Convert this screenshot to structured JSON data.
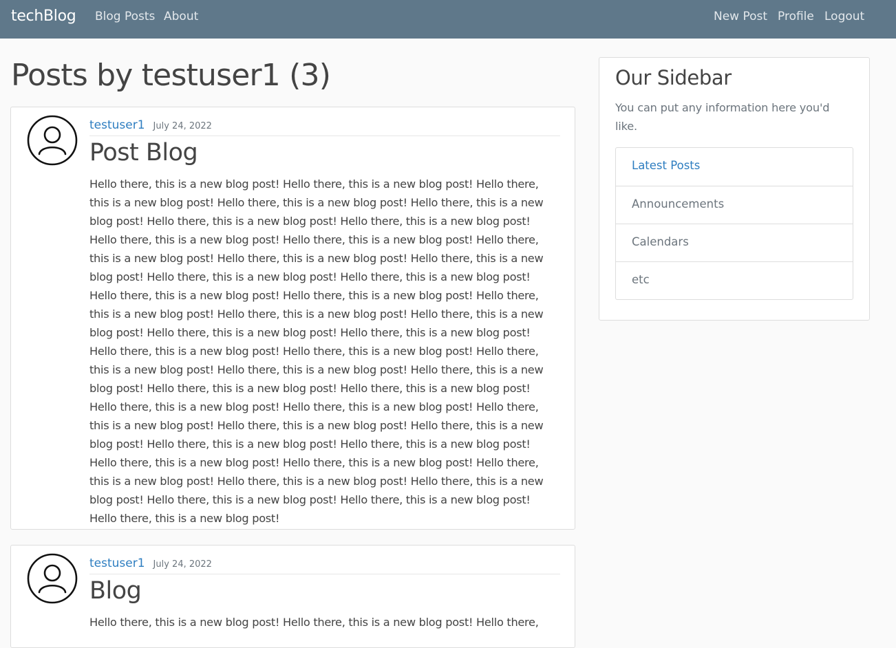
{
  "navbar": {
    "brand": "techBlog",
    "left_links": [
      "Blog Posts",
      "About"
    ],
    "right_links": [
      "New Post",
      "Profile",
      "Logout"
    ]
  },
  "page": {
    "title": "Posts by testuser1 (3)"
  },
  "posts": [
    {
      "author": "testuser1",
      "date": "July 24, 2022",
      "title": "Post Blog",
      "content": "Hello there, this is a new blog post! Hello there, this is a new blog post! Hello there, this is a new blog post! Hello there, this is a new blog post! Hello there, this is a new blog post! Hello there, this is a new blog post! Hello there, this is a new blog post! Hello there, this is a new blog post! Hello there, this is a new blog post! Hello there, this is a new blog post! Hello there, this is a new blog post! Hello there, this is a new blog post! Hello there, this is a new blog post! Hello there, this is a new blog post! Hello there, this is a new blog post! Hello there, this is a new blog post! Hello there, this is a new blog post! Hello there, this is a new blog post! Hello there, this is a new blog post! Hello there, this is a new blog post! Hello there, this is a new blog post! Hello there, this is a new blog post! Hello there, this is a new blog post! Hello there, this is a new blog post! Hello there, this is a new blog post! Hello there, this is a new blog post! Hello there, this is a new blog post! Hello there, this is a new blog post! Hello there, this is a new blog post! Hello there, this is a new blog post! Hello there, this is a new blog post! Hello there, this is a new blog post! Hello there, this is a new blog post! Hello there, this is a new blog post! Hello there, this is a new blog post! Hello there, this is a new blog post! Hello there, this is a new blog post! Hello there, this is a new blog post! Hello there, this is a new blog post! Hello there, this is a new blog post! Hello there, this is a new blog post! Hello there, this is a new blog post! Hello there, this is a new blog post!"
    },
    {
      "author": "testuser1",
      "date": "July 24, 2022",
      "title": "Blog",
      "content": "Hello there, this is a new blog post! Hello there, this is a new blog post! Hello there,"
    }
  ],
  "sidebar": {
    "title": "Our Sidebar",
    "description": "You can put any information here you'd like.",
    "items": [
      {
        "label": "Latest Posts",
        "active": true
      },
      {
        "label": "Announcements",
        "active": false
      },
      {
        "label": "Calendars",
        "active": false
      },
      {
        "label": "etc",
        "active": false
      }
    ]
  },
  "colors": {
    "navbar": "#5f788a",
    "link": "#2d7dc0",
    "muted": "#6c757d",
    "background": "#fafafa"
  },
  "icons": {
    "avatar": "user-avatar-icon"
  }
}
